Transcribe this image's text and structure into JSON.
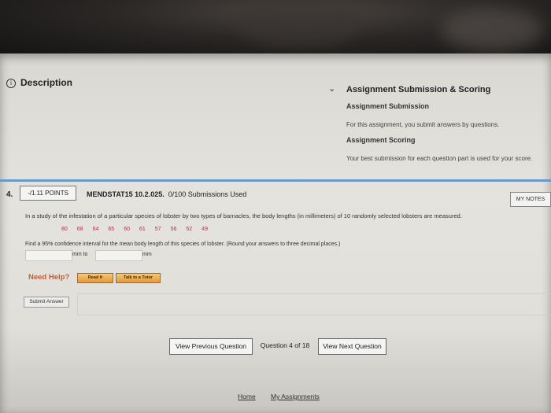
{
  "panel": {
    "description_label": "Description",
    "info_icon": "info-circle-icon",
    "chevron_icon": "chevron-down-icon"
  },
  "scoring": {
    "title": "Assignment Submission & Scoring",
    "submission_heading": "Assignment Submission",
    "submission_text": "For this assignment, you submit answers by questions.",
    "scoring_heading": "Assignment Scoring",
    "scoring_text": "Your best submission for each question part is used for your score."
  },
  "question": {
    "number": "4.",
    "points": "-/1.11 POINTS",
    "code": "MENDSTAT15 10.2.025.",
    "submissions": "0/100 Submissions Used",
    "my_notes": "MY NOTES",
    "text": "In a study of the infestation of a particular species of lobster by two types of barnacles, the body lengths (in millimeters) of 10 randomly selected lobsters are measured.",
    "data": [
      "80",
      "68",
      "64",
      "65",
      "60",
      "61",
      "57",
      "56",
      "52",
      "49"
    ],
    "find_text": "Find a 95% confidence interval for the mean body length of this species of lobster. (Round your answers to three decimal places.)",
    "answer1_value": "",
    "answer2_value": "",
    "unit_to": "mm to",
    "unit_mm": "mm",
    "need_help": "Need Help?",
    "read_it": "Read It",
    "talk_to_tutor": "Talk to a Tutor",
    "submit_answer": "Submit Answer"
  },
  "navigation": {
    "previous": "View Previous Question",
    "position": "Question 4 of 18",
    "next": "View Next Question"
  },
  "footer": {
    "home": "Home",
    "my_assignments": "My Assignments"
  },
  "colors": {
    "accent_bar": "#6f97c5",
    "data_values": "#b0324a",
    "need_help": "#c65d2b",
    "help_buttons": "#e19a3c"
  }
}
